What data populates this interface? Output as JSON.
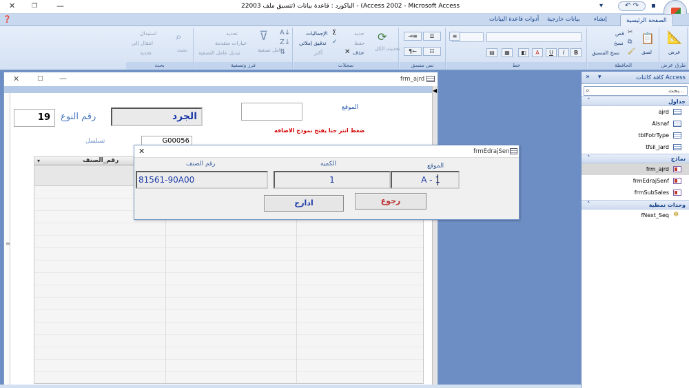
{
  "window": {
    "title": "2الباكورد : قاعدة بيانات (تنسيق ملف 2003 - (Access 2002 - Microsoft Access",
    "close_icon": "close-icon",
    "restore_icon": "restore-icon",
    "minimize_icon": "minimize-icon"
  },
  "ribbon": {
    "tabs": [
      {
        "label": "الصفحة الرئيسية",
        "active": true
      },
      {
        "label": "إنشاء"
      },
      {
        "label": "بيانات خارجية"
      },
      {
        "label": "أدوات قاعدة البيانات"
      }
    ],
    "groups": {
      "views": {
        "label": "طرق عرض",
        "view_button": "عرض"
      },
      "clipboard": {
        "label": "الحافظة",
        "paste": "لصق",
        "cut": "قص",
        "copy": "نسخ",
        "format_painter": "نسخ التنسيق"
      },
      "font": {
        "label": "خط",
        "bold": "B",
        "italic": "I",
        "underline": "U",
        "font_color": "A"
      },
      "rich_text": {
        "label": "نص منسق"
      },
      "records": {
        "label": "سجلات",
        "refresh_all": "تحديث الكل",
        "new": "جديد",
        "save": "حفظ",
        "delete": "حذف",
        "totals": "الإجماليات",
        "spelling": "تدقيق إملائي",
        "more": "أكثر"
      },
      "sort_filter": {
        "label": "فرز وتصفية",
        "filter": "عامل تصفية",
        "selection": "تحديد",
        "advanced": "خيارات متقدمة",
        "toggle_filter": "تبديل عامل التصفية"
      },
      "find": {
        "label": "بحث",
        "find": "بحث",
        "replace": "استبدال",
        "goto": "انتقال إلى",
        "select": "تحديد"
      }
    }
  },
  "nav": {
    "title": "كافة كائنات Access",
    "search_placeholder": "بحث...",
    "sections": [
      {
        "label": "جداول",
        "items": [
          "ajrd",
          "Alsnaf",
          "tblFotrType",
          "tfsil_jard"
        ]
      },
      {
        "label": "نماذج",
        "items": [
          "frm_ajrd",
          "frmEdrajSenf",
          "frmSubSales"
        ]
      },
      {
        "label": "وحدات نمطية",
        "items": [
          "fNext_Seq"
        ]
      }
    ],
    "selected_item": "frm_ajrd"
  },
  "doc": {
    "title": "frm_ajrd",
    "form": {
      "type_number_label": "رقم النوع",
      "type_number_value": "19",
      "name_value": "الجرد",
      "location_label": "الموقع",
      "hint": "ضغط انتر حتا يفتح نموذج الاضافه",
      "serial_label": "تسلسل",
      "serial_value": "G00056",
      "grid_col1": "رقم_الصنف"
    }
  },
  "dialog": {
    "title": "frmEdrajSenf",
    "labels": {
      "location": "الموقع",
      "quantity": "الكميه",
      "item_number": "رقم الصنف"
    },
    "values": {
      "location": "A - 1",
      "quantity": "1",
      "item_number": "81561-90A00"
    },
    "buttons": {
      "back": "رجوع",
      "insert": "ادارج"
    }
  }
}
